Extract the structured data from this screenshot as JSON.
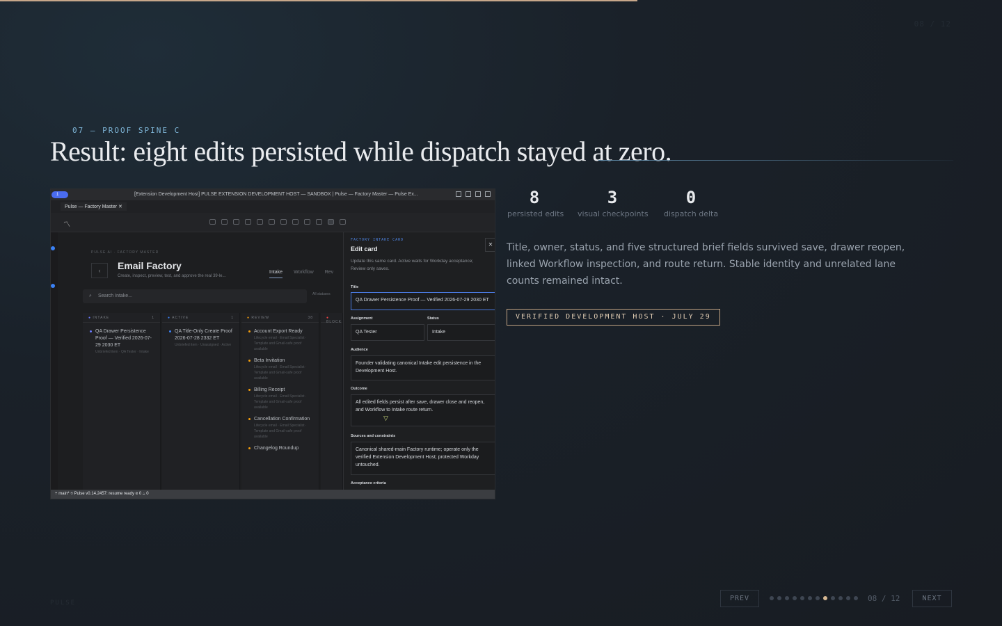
{
  "colors": {
    "accent": "#c7a78a",
    "eyebrow": "#7fb6d8",
    "active_dot": "#d7b893"
  },
  "corner": {
    "counter": "08 / 12"
  },
  "header": {
    "eyebrow": "07 — PROOF SPINE C",
    "title": "Result: eight edits persisted while dispatch stayed at zero."
  },
  "screenshot": {
    "window_badge": "1",
    "window_title": "[Extension Development Host] PULSE EXTENSION DEVELOPMENT HOST — SANDBOX | Pulse — Factory Master — Pulse Ex...",
    "tab_label": "Pulse — Factory Master",
    "crumb": "PULSE AI · FACTORY MASTER",
    "app_title": "Email Factory",
    "app_subtitle": "Create, inspect, preview, test, and approve the real 39-le...",
    "view_tabs": [
      "Intake",
      "Workflow",
      "Rev"
    ],
    "search_placeholder": "Search Intake...",
    "status_filter": "All statuses",
    "lanes": [
      {
        "name": "INTAKE",
        "count": "1",
        "color": "#6b7bff",
        "cards": [
          {
            "title": "QA Drawer Persistence Proof — Verified 2026-07-29 2030 ET",
            "meta": "Unbriefed item · QA Tester · Intake"
          }
        ]
      },
      {
        "name": "ACTIVE",
        "count": "1",
        "color": "#3b82f6",
        "cards": [
          {
            "title": "QA Title-Only Create Proof 2026-07-28 2332 ET",
            "meta": "Unbriefed item · Unassigned · Active"
          }
        ]
      },
      {
        "name": "REVIEW",
        "count": "38",
        "color": "#f59e0b",
        "cards": [
          {
            "title": "Account Export Ready",
            "meta": "Lifecycle email · Email Specialist · Template and Gmail-safe proof available"
          },
          {
            "title": "Beta Invitation",
            "meta": "Lifecycle email · Email Specialist · Template and Gmail-safe proof available"
          },
          {
            "title": "Billing Receipt",
            "meta": "Lifecycle email · Email Specialist · Template and Gmail-safe proof available"
          },
          {
            "title": "Cancellation Confirmation",
            "meta": "Lifecycle email · Email Specialist · Template and Gmail-safe proof available"
          },
          {
            "title": "Changelog Roundup",
            "meta": ""
          }
        ]
      },
      {
        "name": "BLOCK",
        "count": "",
        "color": "#ef4444",
        "cards": []
      }
    ],
    "drawer": {
      "eyebrow": "FACTORY INTAKE CARD",
      "title": "Edit card",
      "description": "Update this same card. Active waits for Workday acceptance; Review only saves.",
      "title_label": "Title",
      "title_value": "QA Drawer Persistence Proof — Verified 2026-07-29 2030 ET",
      "assignment_label": "Assignment",
      "assignment_value": "QA Tester",
      "status_label": "Status",
      "status_value": "Intake",
      "audience_label": "Audience",
      "audience_value": "Founder validating canonical Intake edit persistence in the Development Host.",
      "outcome_label": "Outcome",
      "outcome_value": "All edited fields persist after save, drawer close and reopen, and Workflow to Intake route return.",
      "sources_label": "Sources and constraints",
      "sources_value": "Canonical shared-main Factory runtime; operate only the verified Extension Development Host; protected Workday untouched.",
      "acceptance_label": "Acceptance criteria"
    },
    "statusbar": {
      "branch": "main*",
      "pulse": "Pulse v0.14.2457: resume ready",
      "problems": "0 △ 0"
    }
  },
  "stats": [
    {
      "value": "8",
      "label": "persisted edits"
    },
    {
      "value": "3",
      "label": "visual checkpoints"
    },
    {
      "value": "0",
      "label": "dispatch delta"
    }
  ],
  "paragraph": "Title, owner, status, and five structured brief fields survived save, drawer reopen, linked Workflow inspection, and route return. Stable identity and unrelated lane counts remained intact.",
  "tag": "VERIFIED DEVELOPMENT HOST · JULY 29",
  "footer": {
    "brand": "PULSE",
    "prev_label": "PREV",
    "next_label": "NEXT",
    "page_indicator": "08 / 12",
    "total_slides": 12,
    "current_slide": 8
  }
}
